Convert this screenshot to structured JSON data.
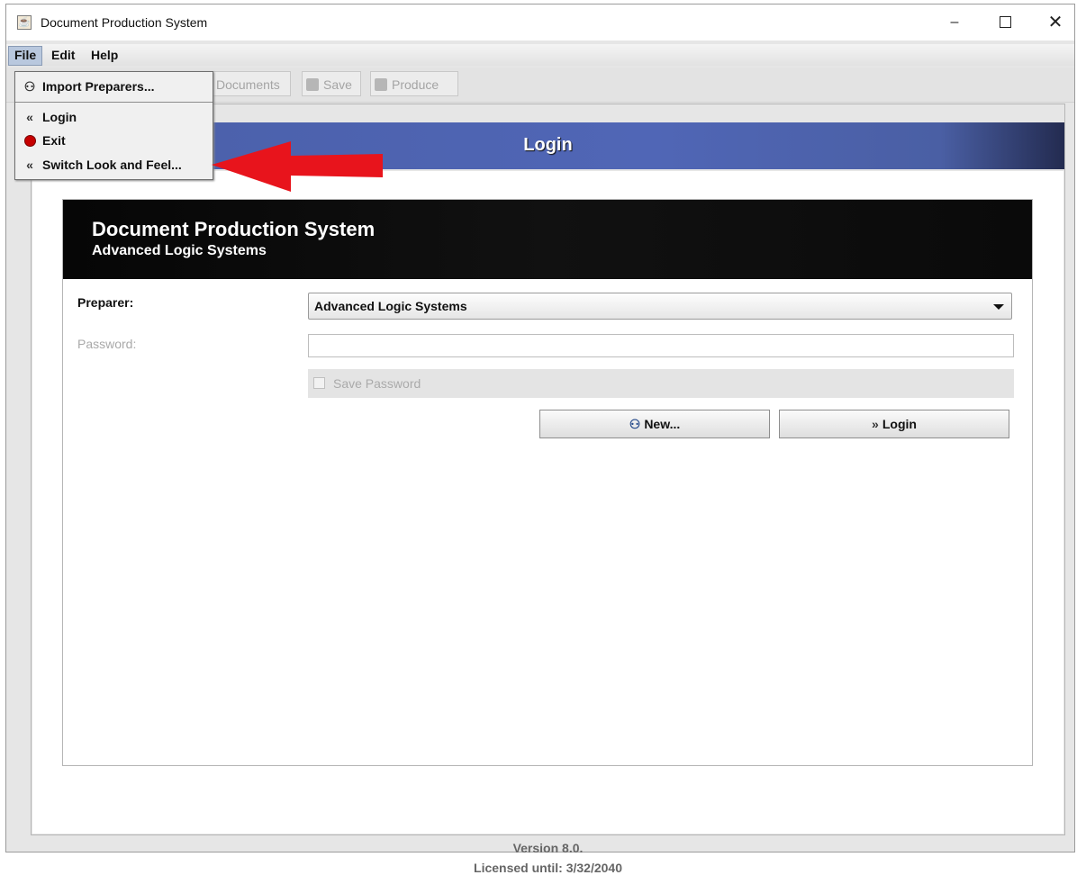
{
  "window": {
    "title": "Document Production System",
    "controls": {
      "minimize": "–",
      "close": "✕"
    }
  },
  "menubar": {
    "file": "File",
    "edit": "Edit",
    "help": "Help"
  },
  "toolbar": {
    "documents": "Documents",
    "save": "Save",
    "produce": "Produce"
  },
  "file_menu": {
    "items": [
      {
        "label": "Import Preparers...",
        "icon": "import-icon"
      },
      {
        "label": "Login",
        "icon": "chevron-left-icon"
      },
      {
        "label": "Exit",
        "icon": "exit-icon"
      },
      {
        "label": "Switch Look and Feel...",
        "icon": "chevron-left-icon"
      }
    ]
  },
  "login_panel": {
    "header": "Login",
    "banner_title": "Document Production System",
    "banner_subtitle": "Advanced Logic Systems",
    "preparer_label": "Preparer:",
    "preparer_value": "Advanced Logic Systems",
    "password_label": "Password:",
    "password_value": "",
    "save_password_label": "Save Password",
    "new_button": "New...",
    "login_button": "Login"
  },
  "footer": {
    "version": "Version 8.0.",
    "license": "Licensed until: 3/32/2040"
  },
  "colors": {
    "header_blue": "#4a5fa8",
    "annotation_arrow": "#e8141c",
    "exit_red": "#c60000"
  }
}
